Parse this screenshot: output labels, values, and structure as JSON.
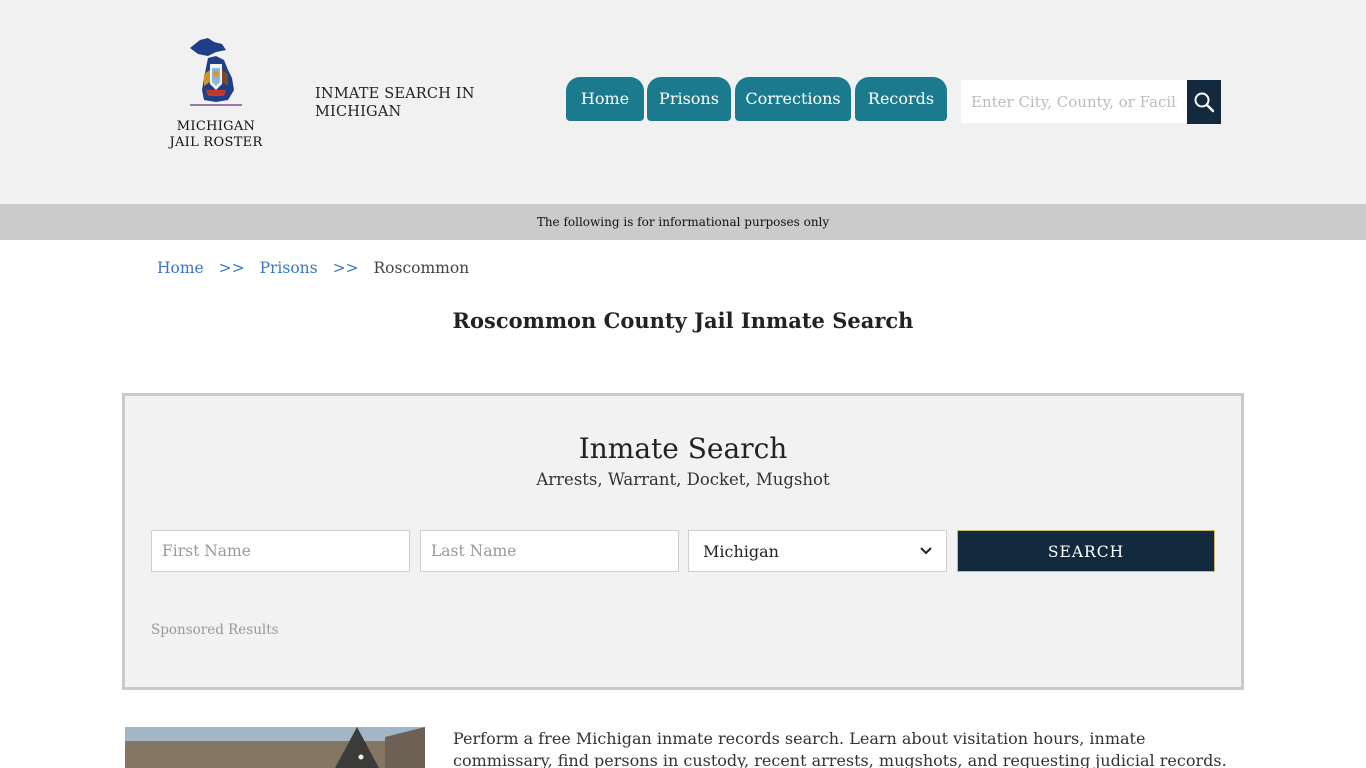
{
  "header": {
    "logo_line1": "MICHIGAN",
    "logo_line2": "JAIL ROSTER",
    "tagline": "INMATE SEARCH IN MICHIGAN"
  },
  "nav": {
    "items": [
      {
        "label": "Home"
      },
      {
        "label": "Prisons"
      },
      {
        "label": "Corrections"
      },
      {
        "label": "Records"
      }
    ]
  },
  "top_search": {
    "placeholder": "Enter City, County, or Facility"
  },
  "info_bar": {
    "text": "The following is for informational purposes only"
  },
  "breadcrumb": {
    "home": "Home",
    "sep": ">>",
    "prisons": "Prisons",
    "current": "Roscommon"
  },
  "page_title": "Roscommon County Jail Inmate Search",
  "search_box": {
    "title": "Inmate Search",
    "subtitle": "Arrests, Warrant, Docket, Mugshot",
    "first_name_placeholder": "First Name",
    "last_name_placeholder": "Last Name",
    "state_value": "Michigan",
    "button_label": "SEARCH",
    "sponsored": "Sponsored Results"
  },
  "intro": {
    "text": "Perform a free Michigan inmate records search. Learn about visitation hours, inmate commissary, find persons in custody, recent arrests, mugshots, and requesting judicial records."
  },
  "colors": {
    "nav": "#1c7a8f",
    "dark": "#13293d",
    "link": "#3a76c3"
  }
}
